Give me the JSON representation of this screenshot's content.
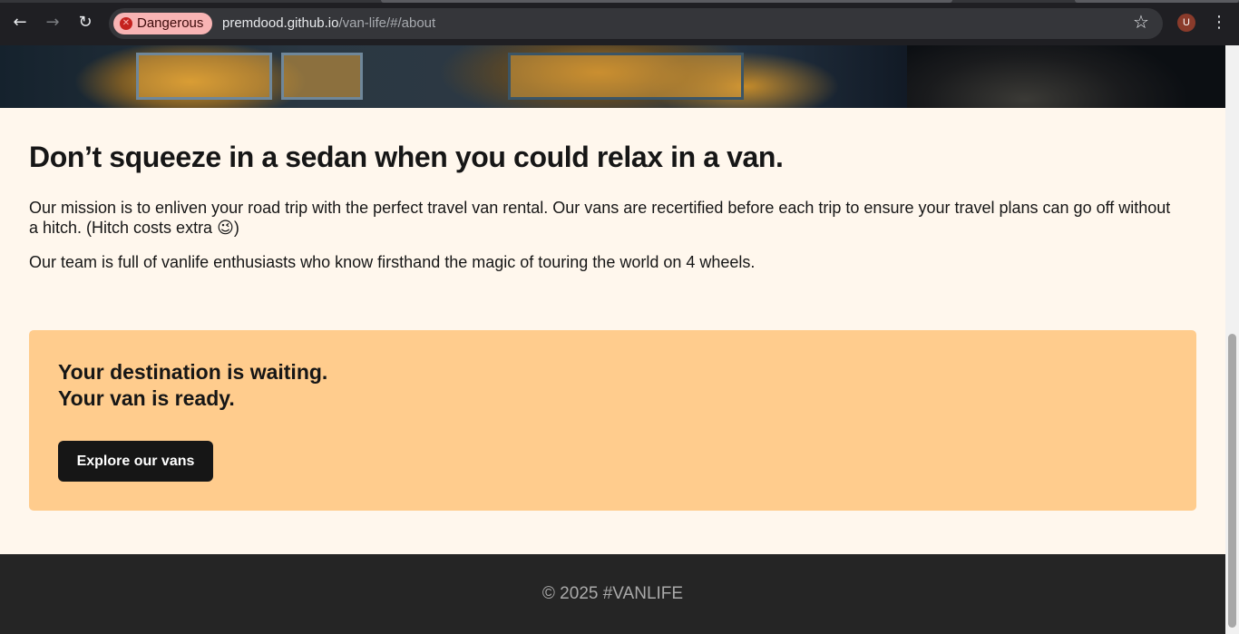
{
  "browser": {
    "security_chip": "Dangerous",
    "url_host": "premdood.github.io",
    "url_path": "/van-life/#/about",
    "profile_initial": "U",
    "icons": [
      "back-icon",
      "forward-icon",
      "reload-icon",
      "danger-icon",
      "star-icon",
      "kebab-menu-icon"
    ]
  },
  "about": {
    "heading": "Don’t squeeze in a sedan when you could relax in a van.",
    "mission": "Our mission is to enliven your road trip with the perfect travel van rental. Our vans are recertified before each trip to ensure your travel plans can go off without a hitch. (Hitch costs extra 😉)",
    "team": "Our team is full of vanlife enthusiasts who know firsthand the magic of touring the world on 4 wheels."
  },
  "cta": {
    "line1": "Your destination is waiting.",
    "line2": "Your van is ready.",
    "button": "Explore our vans"
  },
  "footer": {
    "text": "© 2025 #VANLIFE"
  },
  "colors": {
    "page_bg": "#FFF7ED",
    "cta_bg": "#FFCC8D",
    "button_bg": "#161616",
    "footer_bg": "#252525",
    "footer_text": "#AAAAAA",
    "danger_chip": "#F8B4B4"
  }
}
